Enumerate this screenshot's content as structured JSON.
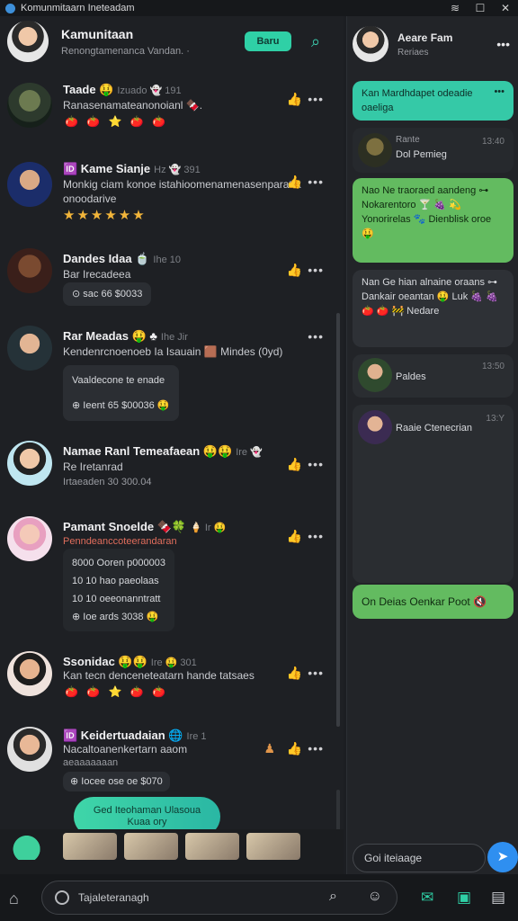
{
  "window": {
    "title": "Komunmitaarn Ineteadam"
  },
  "left_header": {
    "name": "Kamunitaan",
    "subtitle": "Renongtamenanca Vandan. ·",
    "new_button": "Baru"
  },
  "feed": [
    {
      "name": "Taade 🤑",
      "meta": "Izuado 👻 191",
      "line1": "Ranasenamateanonoianl 🍫.",
      "line2": "🍅 🍅 ⭐ 🍅 🍅",
      "kind": "emoji"
    },
    {
      "name": "🆔 Kame Sianje",
      "meta": "Hz 👻 391",
      "line1": "Monkig ciam konoe istahioomenamenasenparatrk",
      "line2": "onoodarive",
      "stars": "★★★★★★",
      "kind": "stars"
    },
    {
      "name": "Dandes Idaa 🍵",
      "meta": "Ihe 10",
      "line1": "Bar Irecadeea",
      "chip": "⊙ sac  66 $0033",
      "kind": "chip"
    },
    {
      "name": "Rar Meadas 🤑 ♣",
      "meta": "Ihe Jir",
      "line1": "Kendenrcnoenoeb Ia Isauain 🟫 Mindes (0yd)",
      "chip_lines": [
        "Vaaldecone te enade",
        "⊕ Ieent  65 $00036 🤑"
      ],
      "kind": "chip2"
    },
    {
      "name": "Namae Ranl Temeafaean 🤑🤑",
      "meta": "Ire 👻",
      "line1": "Re Iretanrad",
      "line2": "Irtaeaden 30 300.04",
      "kind": "dim"
    },
    {
      "name": "Pamant Snoelde 🍫🍀",
      "meta": "🍦 Ir 🤑",
      "line1": "Penndeanccoteerandaran",
      "chip_lines": [
        "8000  Ooren p000003",
        "10 10 hao  paeolaas",
        "10 10  oeeonanntratt",
        "⊕ Ioe  ards  3038 🤑"
      ],
      "kind": "chip4"
    },
    {
      "name": "Ssonidac 🤑🤑",
      "meta": "Ire 🤑 301",
      "line1": "Kan tecn denceneteatarn hande tatsaes",
      "line2": "🍅 🍅 ⭐ 🍅 🍅",
      "kind": "emoji"
    },
    {
      "name": "🆔 Keidertuadaian 🌐",
      "meta": "Ire 1",
      "line1": "Nacaltoanenkertarn aaom",
      "line2": "aeaaaaaaan",
      "chip": "⊕ Iocee  ose  oe $070",
      "kind": "chip"
    }
  ],
  "fab": {
    "label": "Ged Iteohaman Ulasoua Kuaa ory"
  },
  "compose": {
    "placeholder": "Tajaleteranagh"
  },
  "right_header": {
    "name": "Aeare Fam",
    "subtitle": "Reriaes"
  },
  "right_messages": [
    {
      "kind": "teal",
      "text": "Kan Mardhdapet odeadie oaeliga"
    },
    {
      "kind": "dark-user",
      "name": "Dol Pemieg",
      "label": "Rante",
      "time": "13:40"
    },
    {
      "kind": "green",
      "text": "Nao Ne traoraed aandeng ⊶ Nokarentoro 🍸 🍇 💫 Yonorirelas 🐾 Dienblisk oroe 🤑"
    },
    {
      "kind": "dark",
      "text": "Nan Ge hian alnaine oraans ⊶ Dankair oeantan 🤑 Luk 🍇 🍇 🍅 🍅 🚧 Nedare"
    },
    {
      "kind": "dark-user",
      "name": "Paldes",
      "label": "",
      "time": "13:50"
    },
    {
      "kind": "dark-user",
      "name": "Raaie Ctenecrian",
      "label": "",
      "time": "13:Y"
    },
    {
      "kind": "green",
      "text": "On Deias Oenkar Poot 🔇"
    }
  ],
  "right_input": {
    "placeholder": "Goi iteiaage"
  }
}
